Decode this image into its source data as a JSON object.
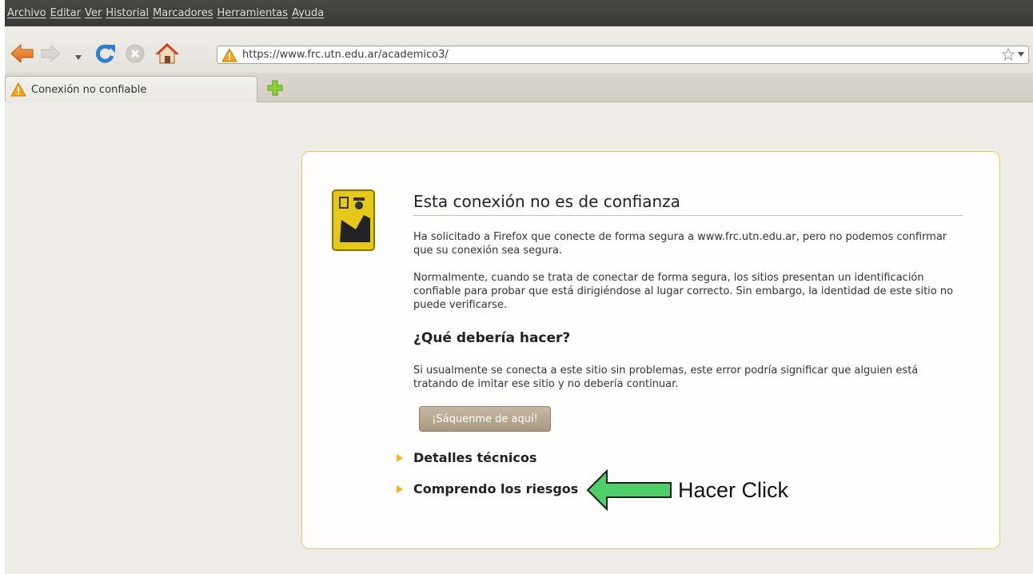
{
  "menubar": {
    "items": [
      "Archivo",
      "Editar",
      "Ver",
      "Historial",
      "Marcadores",
      "Herramientas",
      "Ayuda"
    ]
  },
  "toolbar": {
    "url": "https://www.frc.utn.edu.ar/academico3/",
    "icons": [
      "back-arrow-icon",
      "forward-arrow-icon",
      "history-dropdown-icon",
      "reload-icon",
      "stop-icon",
      "home-icon",
      "warning-icon",
      "bookmark-star-icon"
    ]
  },
  "tabs": [
    {
      "label": "Conexión no confiable",
      "icon": "warning-icon",
      "active": true
    }
  ],
  "error": {
    "title": "Esta conexión no es de confianza",
    "para1": "Ha solicitado a Firefox que conecte de forma segura a www.frc.utn.edu.ar, pero no podemos confirmar que su conexión sea segura.",
    "para2": "Normalmente, cuando se trata de conectar de forma segura, los sitios presentan un identificación confiable para probar que está dirigiéndose al lugar correcto. Sin embargo, la identidad de este sitio no puede verificarse.",
    "what_title": "¿Qué debería hacer?",
    "para3": "Si usualmente se conecta a este sitio sin problemas, este error podría significar que alguien está tratando de imitar ese sitio y no debería continuar.",
    "getout_button": "¡Sáquenme de aquí!",
    "technical_details": "Detalles técnicos",
    "understand_risks": "Comprendo los riesgos"
  },
  "annotation": {
    "text": "Hacer Click",
    "arrow_color": "#4fcf6a"
  },
  "colors": {
    "menubar_bg": "#3c3b37",
    "page_bg": "#efebe7",
    "box_border": "#f0c35a",
    "expander_triangle": "#f1b419"
  }
}
